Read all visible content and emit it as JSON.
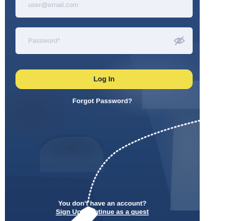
{
  "form": {
    "email_placeholder": "user@email.com",
    "password_placeholder": "Password*",
    "toggle_visibility_icon": "eye-off-icon",
    "login_label": "Log In",
    "forgot_password_label": "Forgot Password?"
  },
  "footer": {
    "no_account_text": "You don't have an account?",
    "sign_up_label": "Sign Up",
    "guest_label": "Continue as a guest"
  },
  "colors": {
    "background": "#22406d",
    "input_background": "#eef1f8",
    "login_button": "#f1e04c",
    "login_text": "#0f1e3a",
    "text": "#ffffff"
  },
  "decoration": {
    "pointer_icon": "hand-pointer-icon"
  }
}
